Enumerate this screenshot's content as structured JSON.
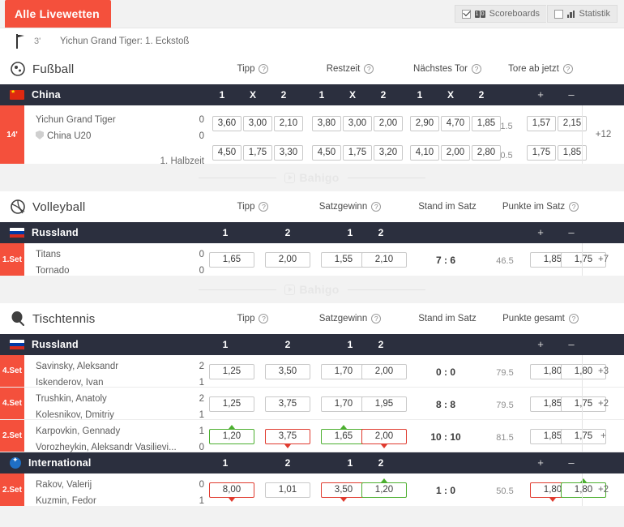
{
  "topbar": {
    "live_tab": "Alle Livewetten",
    "toggles": [
      {
        "label": "Scoreboards",
        "checked": true,
        "icon": "scoreboard-icon",
        "digits": [
          "1",
          "0"
        ]
      },
      {
        "label": "Statistik",
        "checked": false,
        "icon": "bar-chart-icon"
      }
    ]
  },
  "ticker": {
    "icon": "corner-flag-icon",
    "minute": "3'",
    "text": "Yichun Grand Tiger: 1. Eckstoß"
  },
  "help_glyph": "?",
  "watermark": {
    "text": "Bahigo"
  },
  "sports": [
    {
      "name": "Fußball",
      "icon": "soccer-ball-icon",
      "colgroups": [
        {
          "label": "Tipp",
          "help": true
        },
        {
          "label": "Restzeit",
          "help": true
        },
        {
          "label": "Nächstes Tor",
          "help": true
        },
        {
          "label": "Tore ab jetzt",
          "help": true
        }
      ],
      "columns": [
        "1",
        "X",
        "2",
        "1",
        "X",
        "2",
        "1",
        "X",
        "2",
        "+",
        "–"
      ],
      "league": {
        "name": "China",
        "flag": "cn"
      },
      "matches": [
        {
          "badge": "14'",
          "home": "Yichun Grand Tiger",
          "away": "China U20",
          "away_shield": true,
          "home_score": "0",
          "away_score": "0",
          "sub_label": "1. Halbzeit",
          "odds_row1": [
            "3,60",
            "3,00",
            "2,10",
            "3,80",
            "3,00",
            "2,00",
            "2,90",
            "4,70",
            "1,85"
          ],
          "odds_row2": [
            "4,50",
            "1,75",
            "3,30",
            "4,50",
            "1,75",
            "3,20",
            "4,10",
            "2,00",
            "2,80"
          ],
          "handicap1": "1.5",
          "handicap2": "0.5",
          "total1": [
            "1,57",
            "2,15"
          ],
          "total2": [
            "1,75",
            "1,85"
          ],
          "more": "+12"
        }
      ]
    },
    {
      "name": "Volleyball",
      "icon": "volleyball-icon",
      "colgroups": [
        {
          "label": "Tipp",
          "help": true
        },
        {
          "label": "Satzgewinn",
          "help": true
        },
        {
          "label": "Stand im Satz",
          "help": false
        },
        {
          "label": "Punkte im Satz",
          "help": true
        }
      ],
      "columns": [
        "1",
        "2",
        "1",
        "2",
        "+",
        "–"
      ],
      "league": {
        "name": "Russland",
        "flag": "ru"
      },
      "matches": [
        {
          "badge": "1.Set",
          "home": "Titans",
          "away": "Tornado",
          "home_score": "0",
          "away_score": "0",
          "odds": [
            "1,65",
            "2,00",
            "1,55",
            "2,10"
          ],
          "odds_state": [
            "",
            "",
            "",
            ""
          ],
          "set_score": "7 : 6",
          "line": "46.5",
          "totals": [
            "1,85",
            "1,75"
          ],
          "totals_state": [
            "",
            ""
          ],
          "more": "+7"
        }
      ]
    },
    {
      "name": "Tischtennis",
      "icon": "table-tennis-icon",
      "colgroups": [
        {
          "label": "Tipp",
          "help": true
        },
        {
          "label": "Satzgewinn",
          "help": true
        },
        {
          "label": "Stand im Satz",
          "help": false
        },
        {
          "label": "Punkte gesamt",
          "help": true
        }
      ],
      "columns": [
        "1",
        "2",
        "1",
        "2",
        "+",
        "–"
      ],
      "leagues": [
        {
          "name": "Russland",
          "flag": "ru",
          "matches": [
            {
              "badge": "4.Set",
              "home": "Savinsky, Aleksandr",
              "away": "Iskenderov, Ivan",
              "home_score": "2",
              "away_score": "1",
              "odds": [
                "1,25",
                "3,50",
                "1,70",
                "2,00"
              ],
              "odds_state": [
                "",
                "",
                "",
                ""
              ],
              "set_score": "0 : 0",
              "line": "79.5",
              "totals": [
                "1,80",
                "1,80"
              ],
              "totals_state": [
                "",
                ""
              ],
              "more": "+3"
            },
            {
              "badge": "4.Set",
              "home": "Trushkin, Anatoly",
              "away": "Kolesnikov, Dmitriy",
              "home_score": "2",
              "away_score": "1",
              "odds": [
                "1,25",
                "3,75",
                "1,70",
                "1,95"
              ],
              "odds_state": [
                "",
                "",
                "",
                ""
              ],
              "set_score": "8 : 8",
              "line": "79.5",
              "totals": [
                "1,85",
                "1,75"
              ],
              "totals_state": [
                "",
                ""
              ],
              "more": "+2"
            },
            {
              "badge": "2.Set",
              "home": "Karpovkin, Gennady",
              "away": "Vorozheykin, Aleksandr Vasilievi...",
              "home_score": "1",
              "away_score": "0",
              "odds": [
                "1,20",
                "3,75",
                "1,65",
                "2,00"
              ],
              "odds_state": [
                "up",
                "down",
                "up",
                "down"
              ],
              "set_score": "10 : 10",
              "line": "81.5",
              "totals": [
                "1,85",
                "1,75"
              ],
              "totals_state": [
                "",
                ""
              ],
              "more": "+"
            }
          ]
        },
        {
          "name": "International",
          "flag": "intl",
          "matches": [
            {
              "badge": "2.Set",
              "home": "Rakov, Valerij",
              "away": "Kuzmin, Fedor",
              "home_score": "0",
              "away_score": "1",
              "odds": [
                "8,00",
                "1,01",
                "3,50",
                "1,20"
              ],
              "odds_state": [
                "down",
                "",
                "down",
                "up"
              ],
              "set_score": "1 : 0",
              "line": "50.5",
              "totals": [
                "1,80",
                "1,80"
              ],
              "totals_state": [
                "down",
                "up"
              ],
              "more": "+2"
            }
          ]
        }
      ]
    }
  ]
}
